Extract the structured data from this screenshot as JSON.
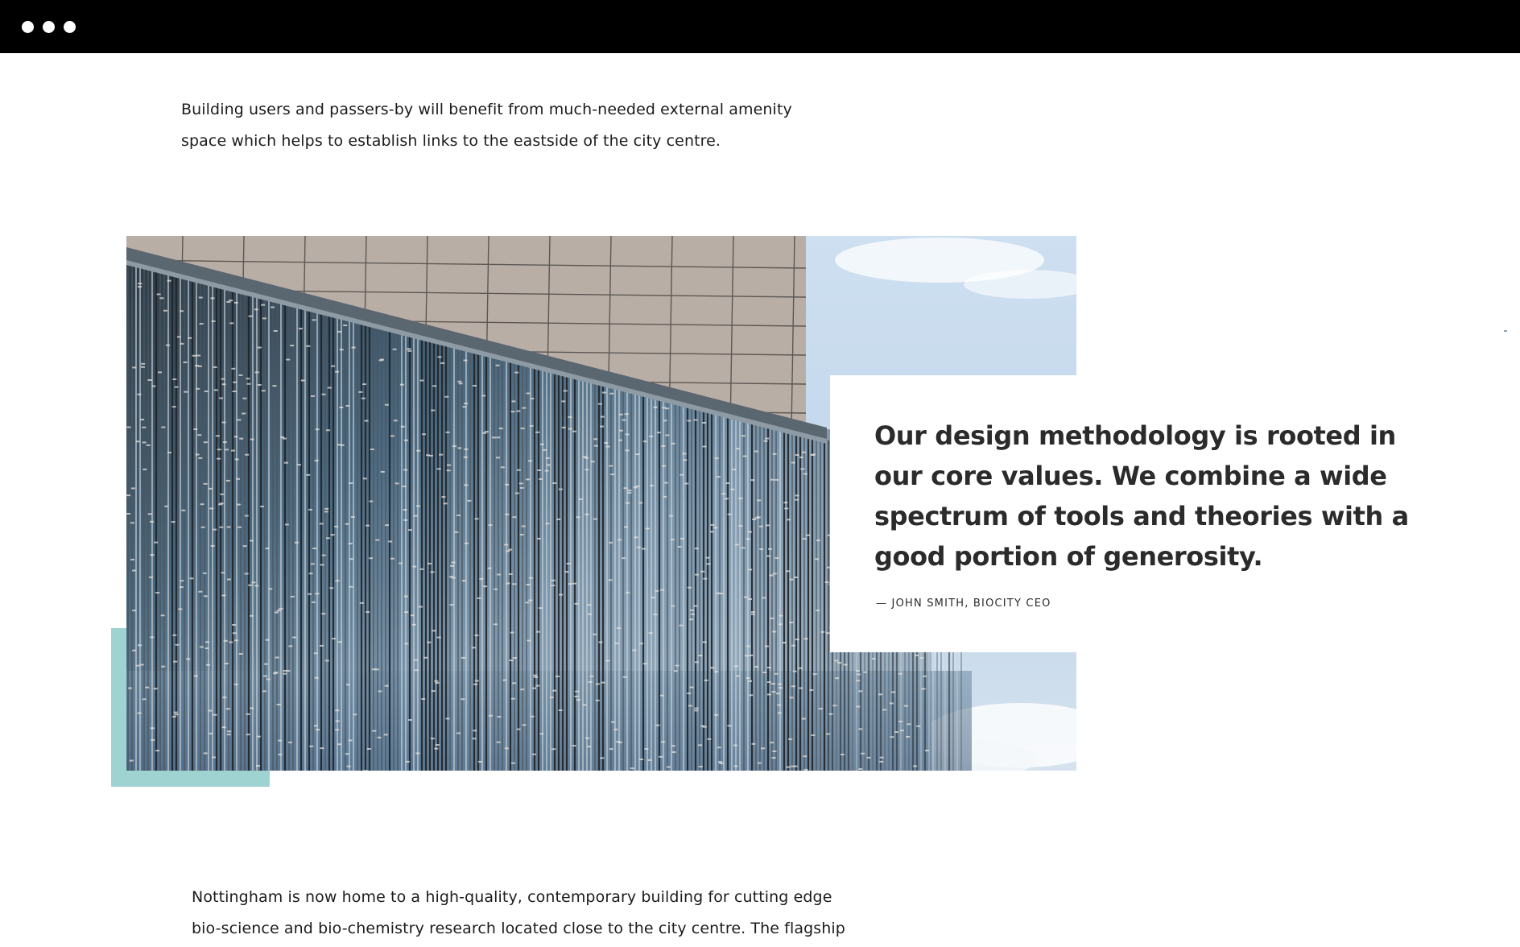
{
  "window": {
    "controls": [
      "window-dot",
      "window-dot",
      "window-dot"
    ]
  },
  "intro": {
    "text": "Building users and passers-by will benefit from much-needed external amenity space which helps to establish links to the eastside of the city centre."
  },
  "feature": {
    "image_alt": "Building facade with vertical fins",
    "quote": "Our design methodology is rooted in our core values. We combine a wide spectrum of tools and theories with a good portion of generosity.",
    "attribution": "— JOHN SMITH, BIOCITY CEO",
    "accent_color": "#9fd3d1"
  },
  "body": {
    "text": "Nottingham is now home to a high-quality, contemporary building for cutting edge bio-science and bio-chemistry research located close to the city centre. The flagship facility contains flexible research space, including a mixture of laboratory"
  },
  "colors": {
    "topbar": "#000000",
    "background": "#ffffff",
    "sky": "#c6d9ec",
    "panel": "#b6aca4"
  }
}
